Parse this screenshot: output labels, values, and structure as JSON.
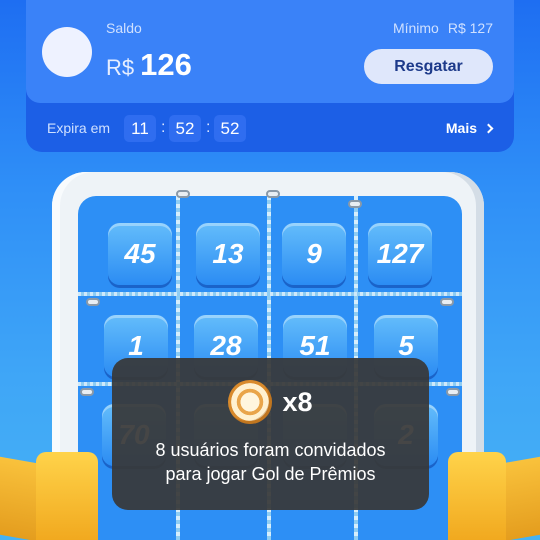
{
  "balance": {
    "label": "Saldo",
    "currency": "R$",
    "amount": "126",
    "minimum_label": "Mínimo",
    "minimum_value": "R$ 127",
    "redeem_label": "Resgatar"
  },
  "expiry": {
    "label": "Expira em",
    "hours": "11",
    "minutes": "52",
    "seconds": "52",
    "separator": ":",
    "more_label": "Mais"
  },
  "board": {
    "rows": [
      [
        "45",
        "13",
        "9",
        "127"
      ],
      [
        "1",
        "28",
        "51",
        "5"
      ],
      [
        "70",
        "",
        "",
        "2"
      ]
    ]
  },
  "toast": {
    "icon": "soccer-ball-icon",
    "count": "x8",
    "line1": "8 usuários foram convidados",
    "line2": "para jogar Gol de Prêmios"
  },
  "colors": {
    "background_top": "#1e6ef2",
    "background_bottom": "#46b2f4",
    "card": "#3a82f8",
    "button": "#dfe7fb",
    "toast": "#383838"
  }
}
